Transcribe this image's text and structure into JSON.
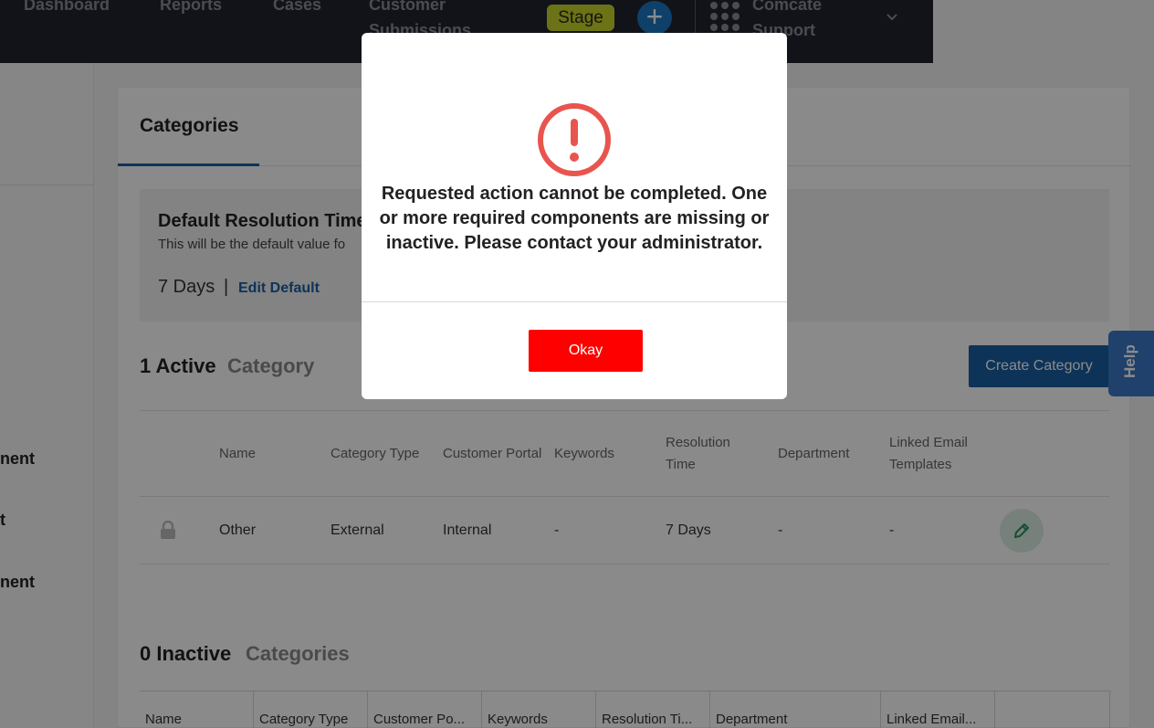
{
  "nav": {
    "links": [
      "Dashboard",
      "Reports",
      "Cases",
      "Customer",
      "Submissions"
    ],
    "stage_label": "Stage",
    "add_glyph": "+",
    "org_line1": "Comcate",
    "org_line2": "Support",
    "bg_color": "#22232e"
  },
  "sidebar": {
    "items": [
      "nent",
      "t",
      "nent"
    ]
  },
  "page": {
    "tab_label": "Categories",
    "default_block": {
      "title": "Default Resolution Time",
      "description": "This will be the default value fo",
      "value": "7 Days",
      "separator": "|",
      "edit_label": "Edit Default"
    },
    "active_section": {
      "count": "1 Active",
      "word": "Category"
    },
    "create_button": "Create Category",
    "active_table": {
      "headers": [
        "Name",
        "Category Type",
        "Customer Portal",
        "Keywords",
        "Resolution",
        "Time",
        "Department",
        "Linked Email",
        "Templates"
      ],
      "rows": [
        {
          "name": "Other",
          "category_type": "External",
          "customer_portal": "Internal",
          "keywords": "-",
          "resolution_time": "7 Days",
          "department": "-",
          "linked_email": "-",
          "locked": true
        }
      ]
    },
    "inactive_section": {
      "count": "0 Inactive",
      "word": "Categories"
    },
    "inactive_table": {
      "headers": [
        "Name",
        "Category Type",
        "Customer Po...",
        "Keywords",
        "Resolution Ti...",
        "Department",
        "Linked Email..."
      ]
    }
  },
  "help_tab": "Help",
  "modal": {
    "icon": "alert-circle-icon",
    "icon_color": "#e8554e",
    "message": "Requested action cannot be completed. One or more required components are missing or inactive. Please contact your administrator.",
    "ok_label": "Okay",
    "ok_color": "#ff0000"
  },
  "colors": {
    "primary": "#1a5fa3",
    "help": "#3a78c8"
  }
}
